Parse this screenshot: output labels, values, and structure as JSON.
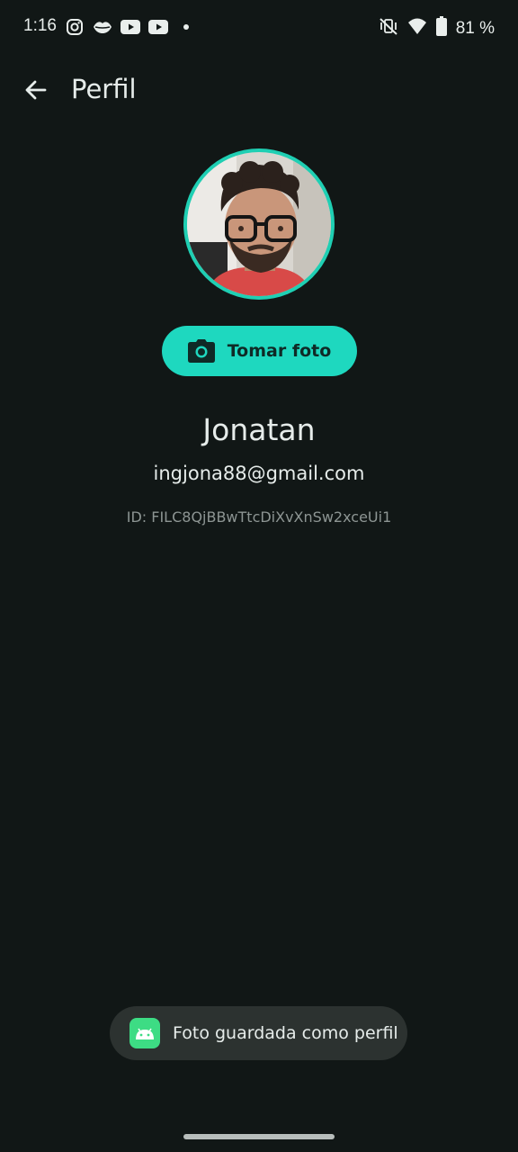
{
  "status_bar": {
    "time": "1:16",
    "notification_icons": [
      "instagram-icon",
      "lips-icon",
      "youtube-icon",
      "youtube-icon",
      "dot-icon"
    ],
    "system_icons": [
      "mute-vibrate-icon",
      "wifi-icon",
      "battery-icon"
    ],
    "battery_level": "81 %"
  },
  "app_bar": {
    "back_icon": "arrow-left-icon",
    "title": "Perfil"
  },
  "profile": {
    "avatar_ring_color": "#1fcfb3",
    "photo_button_label": "Tomar foto",
    "photo_button_icon": "camera-icon",
    "name": "Jonatan",
    "email": "ingjona88@gmail.com",
    "id_text": "ID: FILC8QjBBwTtcDiXvXnSw2xceUi1"
  },
  "toast": {
    "icon": "android-icon",
    "message": "Foto guardada como perfil"
  },
  "colors": {
    "background": "#111716",
    "accent": "#1ed8bf",
    "toast_bg": "#2c3230"
  }
}
